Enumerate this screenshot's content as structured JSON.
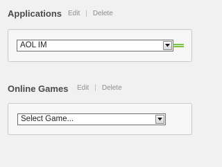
{
  "applications": {
    "title": "Applications",
    "edit_label": "Edit",
    "separator": "|",
    "delete_label": "Delete",
    "select_value": "AOL IM"
  },
  "games": {
    "title": "Online Games",
    "edit_label": "Edit",
    "separator": "|",
    "delete_label": "Delete",
    "select_value": "Select Game..."
  },
  "colors": {
    "background": "#f1f1f1",
    "panel_border": "#c9c9c9",
    "handle_green": "#7cc242"
  },
  "icons": {
    "select_arrow": "chevron-down-icon",
    "drag_handle": "drag-handle-icon"
  }
}
